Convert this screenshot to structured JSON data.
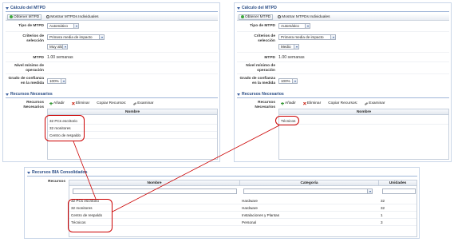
{
  "left_panel": {
    "section_title": "Cálculo del MTPD",
    "toolbar": {
      "obtain_label": "Obtener MTPD",
      "show_individual_label": "Mostrar MTPDs Individuales"
    },
    "tipo_label": "Tipo de MTPD",
    "tipo_value": "Automático",
    "criterios_label": "Criterios de selección",
    "criterios_value": "Primera media de impacto",
    "criterios_sub_value": "Muy alto",
    "mtpd_label": "MTPD",
    "mtpd_value": "1.00 semanas",
    "nivel_label": "Nivel mínimo de operación",
    "grado_label": "Grado de confianza en la medida",
    "grado_value": "100%",
    "resources_section": "Recursos Necesarios",
    "resources_label": "Recursos Necesarios",
    "grid_toolbar": {
      "add": "Añadir",
      "delete": "Eliminar",
      "copy": "Copiar Recursos:",
      "examine": "Examinar"
    },
    "grid_header": "Nombre",
    "rows": [
      "32 PCs escritorio",
      "32 monitores",
      "Centro de respaldo"
    ]
  },
  "right_panel": {
    "section_title": "Cálculo del MTPD",
    "toolbar": {
      "obtain_label": "Obtener MTPD",
      "show_individual_label": "Mostrar MTPDs Individuales"
    },
    "tipo_label": "Tipo de MTPD",
    "tipo_value": "Automático",
    "criterios_label": "Criterios de selección",
    "criterios_value": "Primera media de impacto",
    "criterios_sub_value": "Medio",
    "mtpd_label": "MTPD",
    "mtpd_value": "1.00 semanas",
    "nivel_label": "Nivel mínimo de operación",
    "grado_label": "Grado de confianza en la medida",
    "grado_value": "100%",
    "resources_section": "Recursos Necesarios",
    "resources_label": "Recursos Necesarios",
    "grid_toolbar": {
      "add": "Añadir",
      "delete": "Eliminar",
      "copy": "Copiar Recursos:",
      "examine": "Examinar"
    },
    "grid_header": "Nombre",
    "rows": [
      "Técnicos"
    ]
  },
  "bottom_panel": {
    "section_title": "Recursos BIA Consolidados",
    "resources_label": "Recursos",
    "headers": {
      "nombre": "Nombre",
      "categoria": "Categoría",
      "unidades": "Unidades"
    },
    "rows": [
      {
        "nombre": "32 PCs escritorio",
        "categoria": "Hardware",
        "unidades": "32"
      },
      {
        "nombre": "32 monitores",
        "categoria": "Hardware",
        "unidades": "32"
      },
      {
        "nombre": "Centro de respaldo",
        "categoria": "Instalaciones y Plantas",
        "unidades": "1"
      },
      {
        "nombre": "Técnicos",
        "categoria": "Personal",
        "unidades": "3"
      }
    ]
  },
  "colors": {
    "section_title": "#2a4d86",
    "highlight": "#cc0000"
  }
}
